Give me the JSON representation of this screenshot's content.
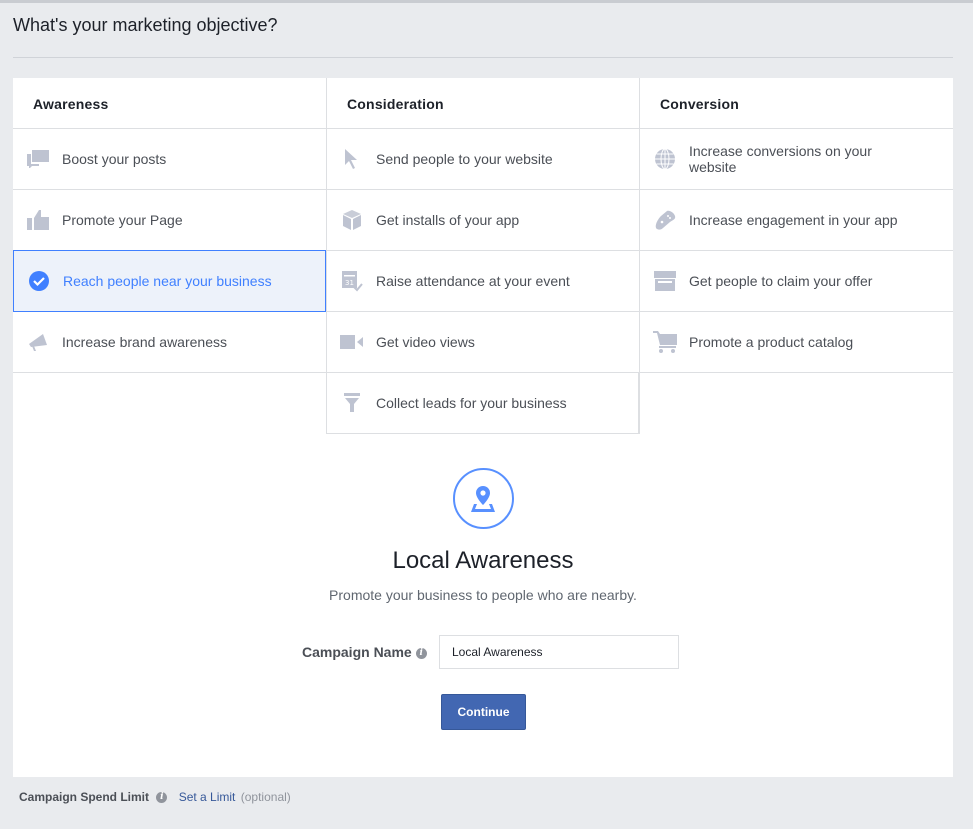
{
  "page": {
    "title": "What's your marketing objective?"
  },
  "columns": [
    {
      "heading": "Awareness",
      "items": [
        {
          "label": "Boost your posts",
          "icon": "speech-bubbles-icon"
        },
        {
          "label": "Promote your Page",
          "icon": "thumbs-up-icon"
        },
        {
          "label": "Reach people near your business",
          "icon": "check-circle-icon",
          "selected": true
        },
        {
          "label": "Increase brand awareness",
          "icon": "megaphone-icon"
        }
      ]
    },
    {
      "heading": "Consideration",
      "items": [
        {
          "label": "Send people to your website",
          "icon": "cursor-icon"
        },
        {
          "label": "Get installs of your app",
          "icon": "cube-icon"
        },
        {
          "label": "Raise attendance at your event",
          "icon": "calendar-icon"
        },
        {
          "label": "Get video views",
          "icon": "video-camera-icon"
        },
        {
          "label": "Collect leads for your business",
          "icon": "funnel-icon"
        }
      ]
    },
    {
      "heading": "Conversion",
      "items": [
        {
          "label": "Increase conversions on your website",
          "icon": "globe-icon"
        },
        {
          "label": "Increase engagement in your app",
          "icon": "gamepad-icon"
        },
        {
          "label": "Get people to claim your offer",
          "icon": "storefront-icon"
        },
        {
          "label": "Promote a product catalog",
          "icon": "shopping-cart-icon"
        }
      ]
    }
  ],
  "detail": {
    "icon": "map-pin-icon",
    "title": "Local Awareness",
    "description": "Promote your business to people who are nearby."
  },
  "form": {
    "campaign_name_label": "Campaign Name",
    "campaign_name_value": "Local Awareness",
    "continue_label": "Continue"
  },
  "footer": {
    "spend_limit_label": "Campaign Spend Limit",
    "set_limit_link": "Set a Limit",
    "optional_text": "(optional)"
  },
  "colors": {
    "accent": "#4080ff",
    "button": "#4267b2",
    "icon_gray": "#bec3d1"
  }
}
